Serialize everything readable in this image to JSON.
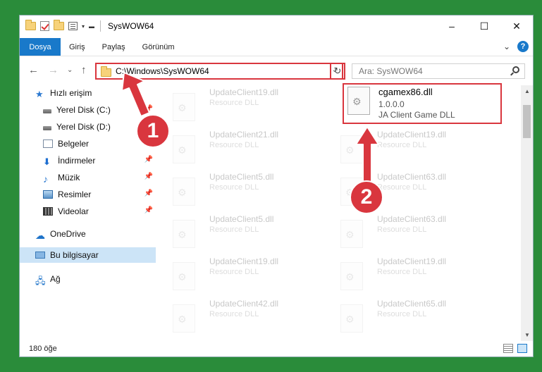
{
  "window": {
    "title": "SysWOW64",
    "controls": {
      "minimize": "–",
      "maximize": "☐",
      "close": "✕"
    }
  },
  "ribbon": {
    "tabs": [
      "Dosya",
      "Giriş",
      "Paylaş",
      "Görünüm"
    ],
    "expand_caret": "⌄",
    "help": "?"
  },
  "nav": {
    "back": "←",
    "forward": "→",
    "recent": "⌄",
    "up": "↑",
    "address": "C:\\Windows\\SysWOW64",
    "address_caret": "⌄",
    "refresh": "↻",
    "search_placeholder": "Ara: SysWOW64"
  },
  "sidebar": {
    "items": [
      {
        "label": "Hızlı erişim",
        "icon": "star-icon",
        "pinned": false
      },
      {
        "label": "Yerel Disk (C:)",
        "icon": "disk-icon",
        "pinned": true
      },
      {
        "label": "Yerel Disk (D:)",
        "icon": "disk-icon",
        "pinned": true
      },
      {
        "label": "Belgeler",
        "icon": "documents-icon",
        "pinned": true
      },
      {
        "label": "İndirmeler",
        "icon": "download-icon",
        "pinned": true
      },
      {
        "label": "Müzik",
        "icon": "music-icon",
        "pinned": true
      },
      {
        "label": "Resimler",
        "icon": "pictures-icon",
        "pinned": true
      },
      {
        "label": "Videolar",
        "icon": "videos-icon",
        "pinned": true
      },
      {
        "label": "OneDrive",
        "icon": "cloud-icon",
        "pinned": false
      },
      {
        "label": "Bu bilgisayar",
        "icon": "computer-icon",
        "pinned": false,
        "selected": true
      },
      {
        "label": "Ağ",
        "icon": "network-icon",
        "pinned": false
      }
    ],
    "pin_glyph": "📌"
  },
  "files": {
    "highlighted": {
      "name": "cgamex86.dll",
      "version": "1.0.0.0",
      "description": "JA Client Game DLL"
    },
    "left_column": [
      {
        "name": "UpdateClient19.dll",
        "type": "Resource DLL"
      },
      {
        "name": "UpdateClient21.dll",
        "type": "Resource DLL"
      },
      {
        "name": "UpdateClient5.dll",
        "type": "Resource DLL"
      },
      {
        "name": "UpdateClient5.dll",
        "type": "Resource DLL"
      },
      {
        "name": "UpdateClient19.dll",
        "type": "Resource DLL"
      },
      {
        "name": "UpdateClient42.dll",
        "type": "Resource DLL"
      }
    ],
    "right_column": [
      {
        "name": "UpdateClient19.dll",
        "type": "Resource DLL"
      },
      {
        "name": "UpdateClient63.dll",
        "type": "Resource DLL"
      },
      {
        "name": "UpdateClient63.dll",
        "type": "Resource DLL"
      },
      {
        "name": "UpdateClient19.dll",
        "type": "Resource DLL"
      },
      {
        "name": "UpdateClient65.dll",
        "type": "Resource DLL"
      }
    ]
  },
  "status": {
    "item_count": "180 öğe"
  },
  "annotations": {
    "step1": "1",
    "step2": "2"
  },
  "colors": {
    "accent": "#1979ca",
    "highlight": "#d9363e",
    "background": "#2a8c3a"
  }
}
